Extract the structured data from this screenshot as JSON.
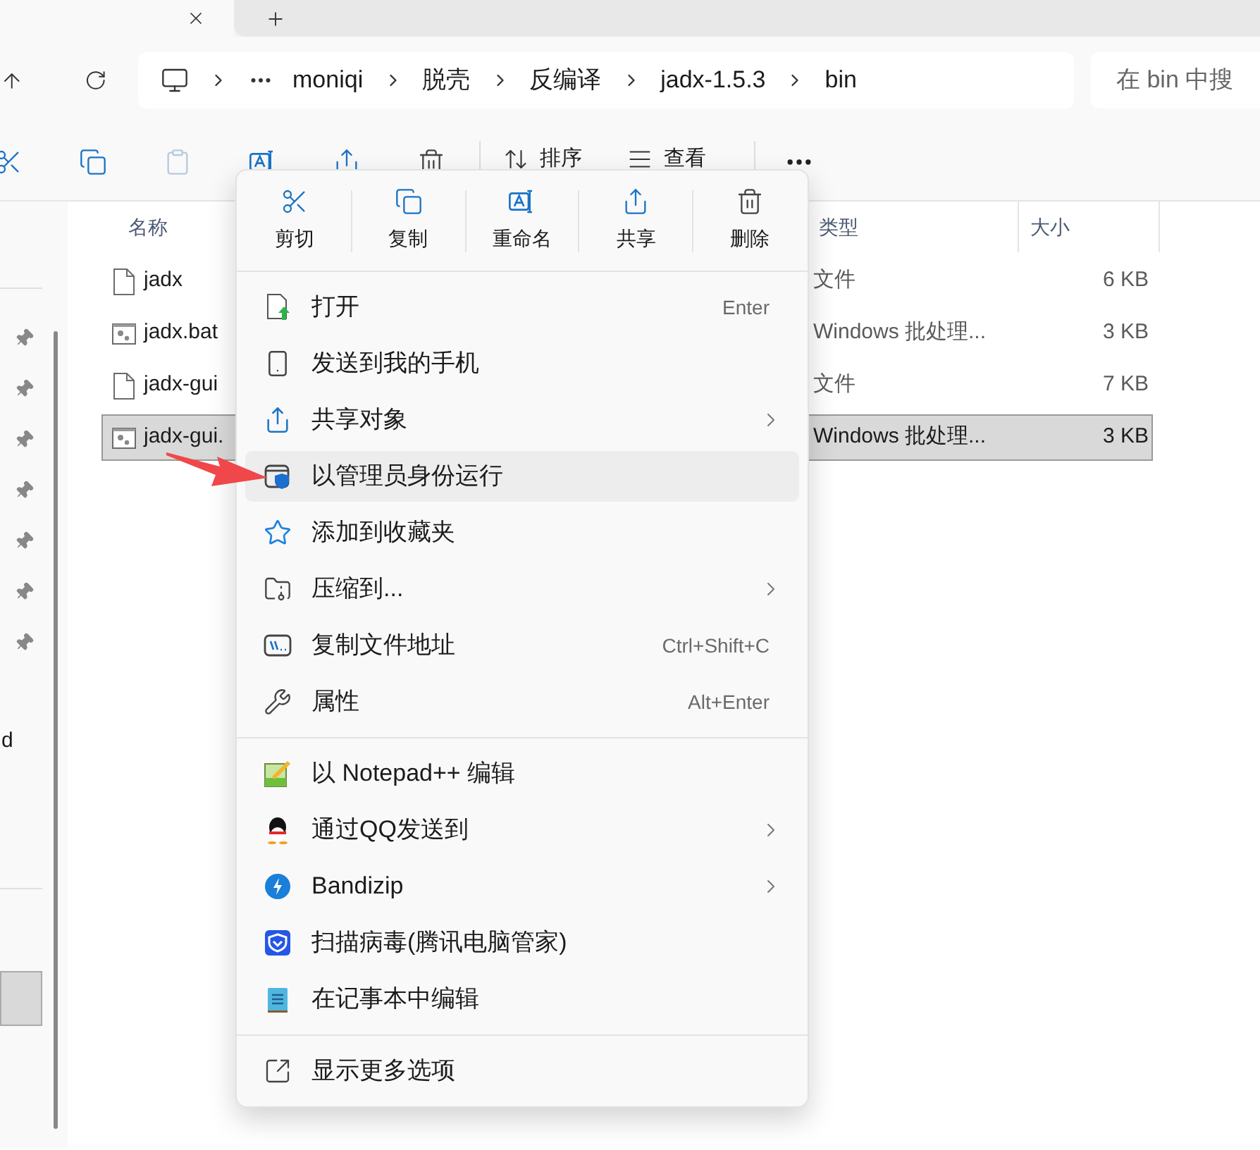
{
  "address_bar": {
    "breadcrumb": [
      "moniqi",
      "脱壳",
      "反编译",
      "jadx-1.5.3",
      "bin"
    ]
  },
  "search": {
    "placeholder": "在 bin 中搜"
  },
  "toolbar": {
    "sort_label": "排序",
    "view_label": "查看"
  },
  "nav_pane": {
    "fragment": "d"
  },
  "file_list": {
    "columns": [
      "名称",
      "类型",
      "大小"
    ],
    "rows": [
      {
        "name": "jadx",
        "type": "文件",
        "size": "6 KB",
        "kind": "file",
        "selected": false
      },
      {
        "name": "jadx.bat",
        "type": "Windows 批处理...",
        "size": "3 KB",
        "kind": "batch",
        "selected": false
      },
      {
        "name": "jadx-gui",
        "type": "文件",
        "size": "7 KB",
        "kind": "file",
        "selected": false
      },
      {
        "name": "jadx-gui.",
        "type": "Windows 批处理...",
        "size": "3 KB",
        "kind": "batch",
        "selected": true
      }
    ]
  },
  "context_menu": {
    "quick_actions": [
      "剪切",
      "复制",
      "重命名",
      "共享",
      "删除"
    ],
    "groups": [
      [
        {
          "label": "打开",
          "shortcut": "Enter",
          "submenu": false,
          "highlighted": false
        },
        {
          "label": "发送到我的手机",
          "submenu": false,
          "highlighted": false
        },
        {
          "label": "共享对象",
          "submenu": true,
          "highlighted": false
        },
        {
          "label": "以管理员身份运行",
          "submenu": false,
          "highlighted": true
        },
        {
          "label": "添加到收藏夹",
          "submenu": false,
          "highlighted": false
        },
        {
          "label": "压缩到...",
          "submenu": true,
          "highlighted": false
        },
        {
          "label": "复制文件地址",
          "shortcut": "Ctrl+Shift+C",
          "submenu": false,
          "highlighted": false
        },
        {
          "label": "属性",
          "shortcut": "Alt+Enter",
          "submenu": false,
          "highlighted": false
        }
      ],
      [
        {
          "label": "以 Notepad++ 编辑",
          "submenu": false,
          "highlighted": false
        },
        {
          "label": "通过QQ发送到",
          "submenu": true,
          "highlighted": false
        },
        {
          "label": "Bandizip",
          "submenu": true,
          "highlighted": false
        },
        {
          "label": "扫描病毒(腾讯电脑管家)",
          "submenu": false,
          "highlighted": false
        },
        {
          "label": "在记事本中编辑",
          "submenu": false,
          "highlighted": false
        }
      ],
      [
        {
          "label": "显示更多选项",
          "submenu": false,
          "highlighted": false
        }
      ]
    ]
  }
}
